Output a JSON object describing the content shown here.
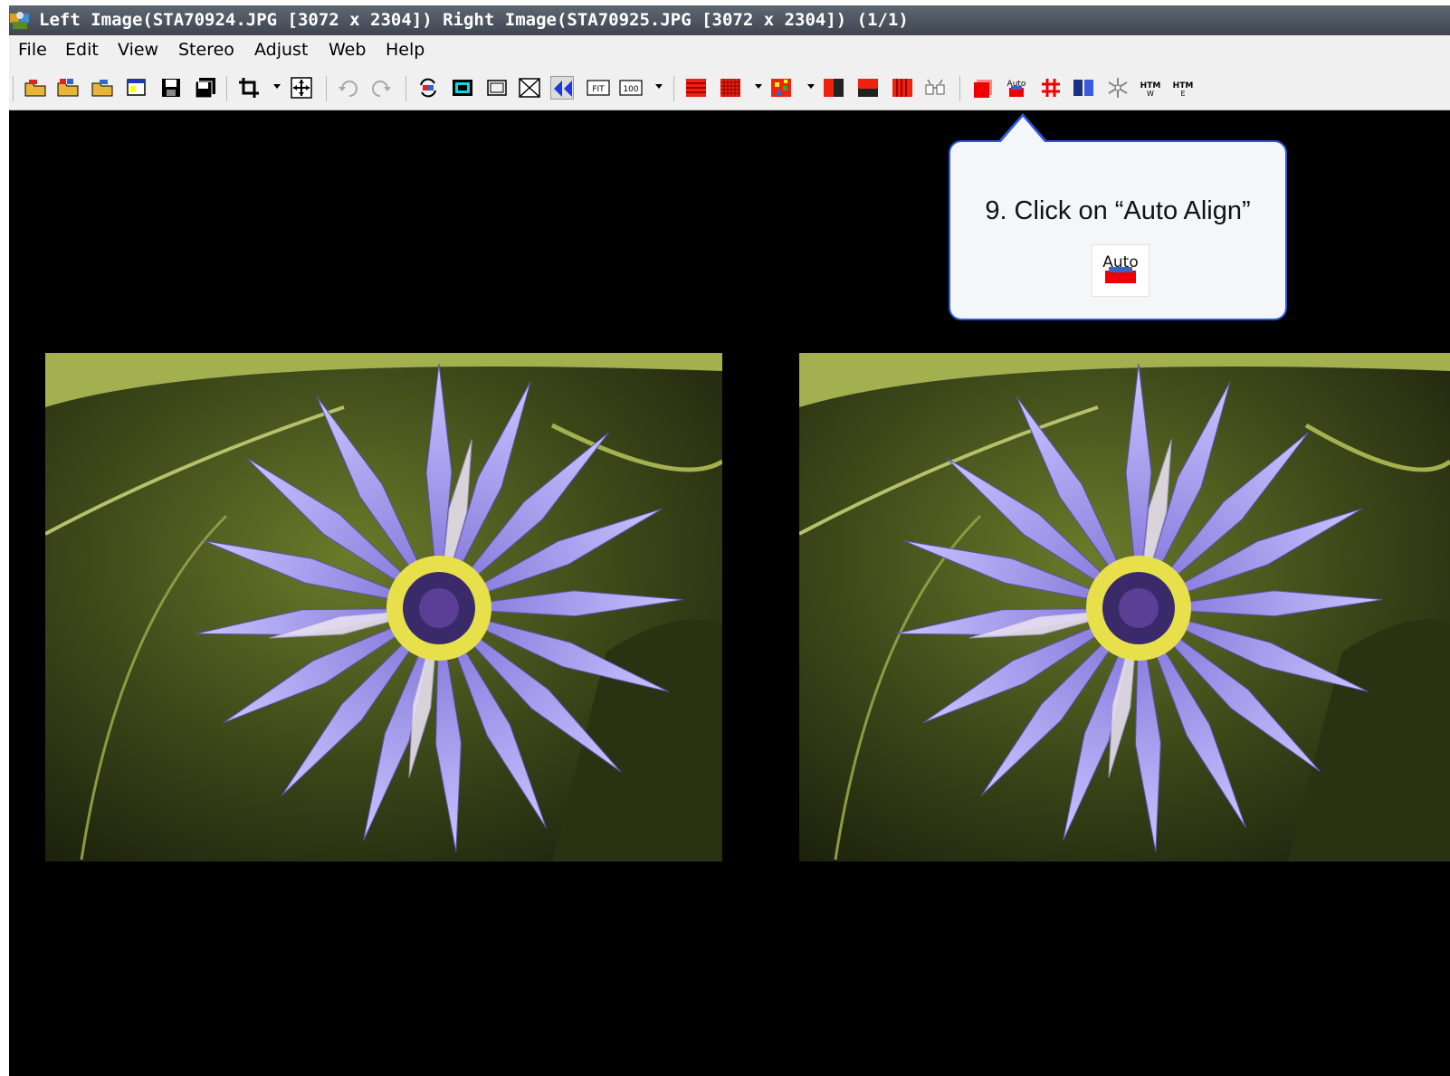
{
  "window": {
    "title": "Left Image(STA70924.JPG [3072 x 2304]) Right Image(STA70925.JPG [3072 x 2304])  (1/1)"
  },
  "menu": [
    "File",
    "Edit",
    "View",
    "Stereo",
    "Adjust",
    "Web",
    "Help"
  ],
  "toolbar": {
    "fit_label": "FIT",
    "zoom_label": "100",
    "auto_label": "Auto",
    "htm_label": "HTM",
    "htm_w_sub": "W",
    "htm_e_sub": "E"
  },
  "callout": {
    "text": "9. Click on “Auto Align”",
    "icon_label": "Auto",
    "icon_name": "auto-align-icon"
  },
  "images": {
    "left": {
      "file": "STA70924.JPG"
    },
    "right": {
      "file": "STA70925.JPG"
    }
  },
  "colors": {
    "callout_border": "#2a5adf",
    "titlebar": "#4b525d",
    "canvas": "#000000"
  }
}
